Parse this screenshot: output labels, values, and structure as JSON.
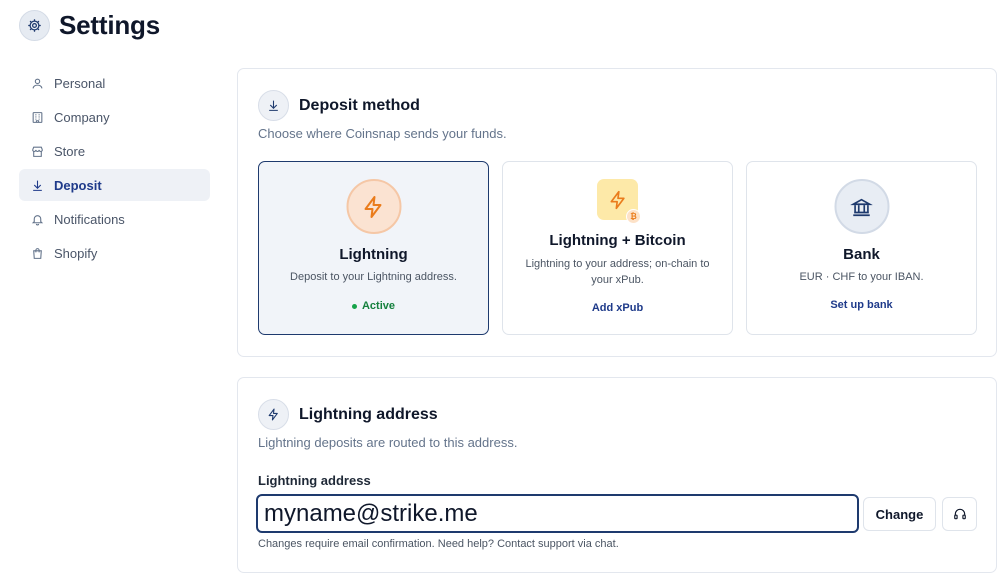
{
  "header": {
    "title": "Settings",
    "icon": "gear-icon"
  },
  "sidebar": {
    "items": [
      {
        "label": "Personal",
        "icon": "user-icon",
        "active": false
      },
      {
        "label": "Company",
        "icon": "building-icon",
        "active": false
      },
      {
        "label": "Store",
        "icon": "store-icon",
        "active": false
      },
      {
        "label": "Deposit",
        "icon": "download-icon",
        "active": true
      },
      {
        "label": "Notifications",
        "icon": "bell-icon",
        "active": false
      },
      {
        "label": "Shopify",
        "icon": "shopping-bag-icon",
        "active": false
      }
    ]
  },
  "deposit": {
    "title": "Deposit method",
    "subtitle": "Choose where Coinsnap sends your funds.",
    "options": [
      {
        "title": "Lightning",
        "description": "Deposit to your Lightning address.",
        "action": "Active",
        "selected": true,
        "icon": "lightning-icon"
      },
      {
        "title": "Lightning + Bitcoin",
        "description": "Lightning to your address; on-chain to your xPub.",
        "action": "Add xPub",
        "selected": false,
        "icon": "lightning-bitcoin-icon"
      },
      {
        "title": "Bank",
        "description": "EUR · CHF to your IBAN.",
        "action": "Set up bank",
        "selected": false,
        "icon": "bank-icon"
      }
    ]
  },
  "lightning_address": {
    "title": "Lightning address",
    "subtitle": "Lightning deposits are routed to this address.",
    "field_label": "Lightning address",
    "value": "myname@strike.me",
    "change_label": "Change",
    "support_icon": "headset-icon",
    "hint": "Changes require email confirmation. Need help? Contact support via chat."
  },
  "colors": {
    "accent": "#1e3a8a",
    "active_green": "#16a34a",
    "lightning_orange": "#ea7c1c"
  }
}
